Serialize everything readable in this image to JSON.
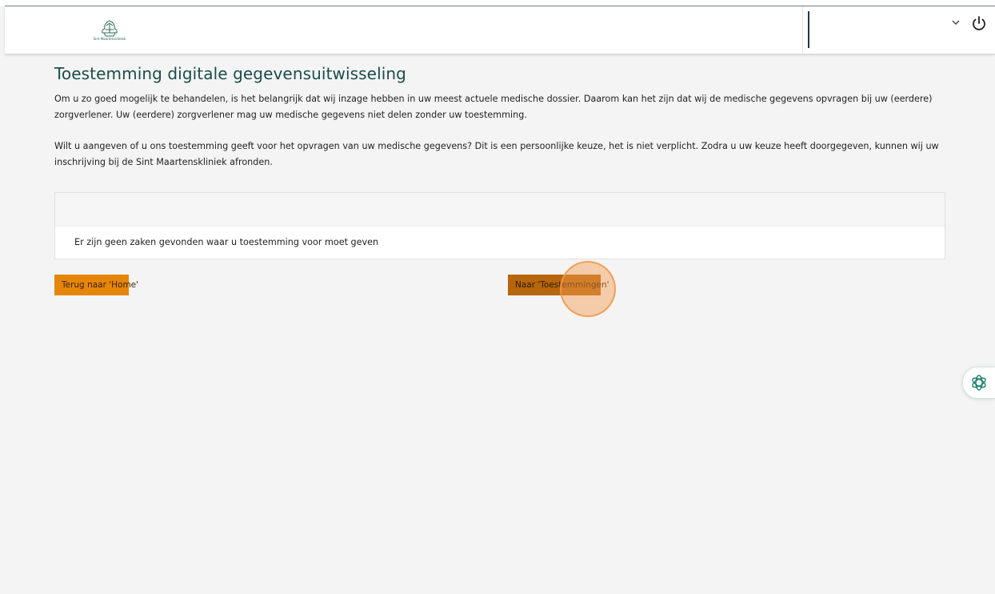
{
  "header": {
    "logo_text": "Sint Maartenskliniek",
    "user_select_value": "",
    "icons": [
      "logo-icon",
      "chevron-down-icon",
      "power-icon"
    ]
  },
  "main": {
    "title": "Toestemming digitale gegevensuitwisseling",
    "paragraph_1": "Om u zo goed mogelijk te behandelen, is het belangrijk dat wij inzage hebben in uw meest actuele medische dossier. Daarom kan het zijn dat wij de medische gegevens opvragen bij uw (eerdere) zorgverlener. Uw (eerdere) zorgverlener mag uw medische gegevens niet delen zonder uw toestemming.",
    "paragraph_2": "Wilt u aangeven of u ons toestemming geeft voor het opvragen van uw medische gegevens? Dit is een persoonlijke keuze, het is niet verplicht. Zodra u uw keuze heeft doorgegeven, kunnen wij uw inschrijving bij de Sint Maartenskliniek afronden.",
    "panel": {
      "empty_message": "Er zijn geen zaken gevonden waar u toestemming voor moet geven"
    },
    "buttons": {
      "home_label": "Terug naar 'Home'",
      "consents_label": "Naar 'Toestemmingen'"
    }
  },
  "colors": {
    "accent": "#e5860a",
    "title": "#1a4d4a",
    "background": "#f4f4f4"
  }
}
